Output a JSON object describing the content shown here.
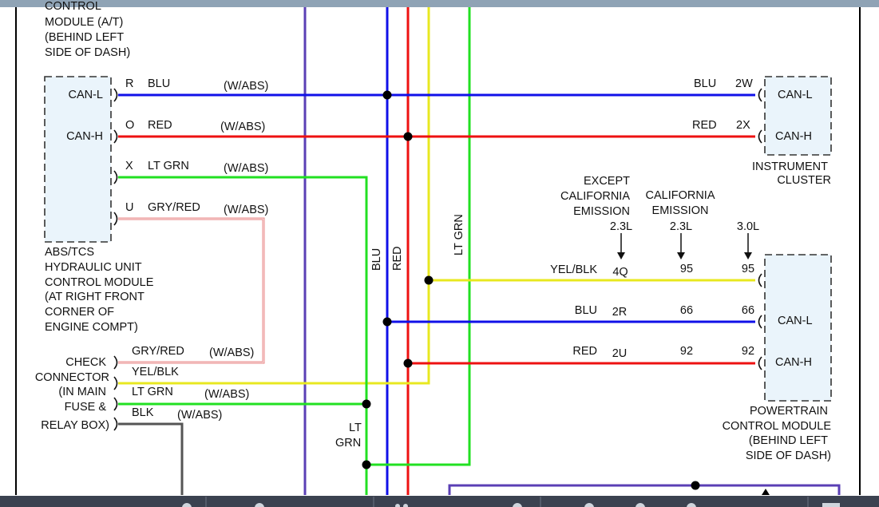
{
  "colors": {
    "blue": "#1010e8",
    "red": "#ee1111",
    "green": "#22e022",
    "yellow": "#e8e820",
    "grey_red": "#e88a8a",
    "black": "#555555",
    "purple": "#5a3fb5",
    "frame": "#000000",
    "toolbar": "#3b4250",
    "topbar": "#8fa3b5"
  },
  "toolbar": {
    "icons": [
      "toolbar-icon-1",
      "toolbar-icon-2",
      "toolbar-icon-3",
      "toolbar-icon-4",
      "toolbar-icon-5",
      "toolbar-icon-6",
      "toolbar-icon-7",
      "toolbar-icon-8",
      "toolbar-icon-9"
    ]
  },
  "pcm_top_label": [
    "CONTROL",
    "MODULE (A/T)",
    "(BEHIND LEFT",
    "SIDE OF DASH)"
  ],
  "abs_module": {
    "pins": [
      "CAN-L",
      "CAN-H"
    ],
    "label": [
      "ABS/TCS",
      "HYDRAULIC UNIT",
      "CONTROL MODULE",
      "(AT RIGHT FRONT",
      "CORNER OF",
      "ENGINE COMPT)"
    ],
    "wires": [
      {
        "pin": "R",
        "color": "BLU",
        "note": "(W/ABS)"
      },
      {
        "pin": "O",
        "color": "RED",
        "note": "(W/ABS)"
      },
      {
        "pin": "X",
        "color": "LT GRN",
        "note": "(W/ABS)"
      },
      {
        "pin": "U",
        "color": "GRY/RED",
        "note": "(W/ABS)"
      }
    ]
  },
  "instrument_cluster": {
    "pins": [
      "CAN-L",
      "CAN-H"
    ],
    "label": [
      "INSTRUMENT",
      "CLUSTER"
    ],
    "wires": [
      {
        "color": "BLU",
        "pin": "2W"
      },
      {
        "color": "RED",
        "pin": "2X"
      }
    ]
  },
  "vertical_labels": {
    "blu": "BLU",
    "red": "RED",
    "lt_grn": "LT GRN"
  },
  "lt_grn_lower": [
    "LT",
    "GRN"
  ],
  "emission": {
    "except_ca": [
      "EXCEPT",
      "CALIFORNIA",
      "EMISSION"
    ],
    "ca": [
      "CALIFORNIA",
      "EMISSION"
    ],
    "engines": [
      "2.3L",
      "2.3L",
      "3.0L"
    ]
  },
  "pcm_wires": [
    {
      "color": "YEL/BLK",
      "pins": [
        "4Q",
        "95",
        "95"
      ]
    },
    {
      "color": "BLU",
      "pins": [
        "2R",
        "66",
        "66"
      ]
    },
    {
      "color": "RED",
      "pins": [
        "2U",
        "92",
        "92"
      ]
    }
  ],
  "pcm_box": {
    "pins": [
      "CAN-L",
      "CAN-H"
    ],
    "label": [
      "POWERTRAIN",
      "CONTROL MODULE",
      "(BEHIND LEFT",
      "SIDE OF DASH)"
    ]
  },
  "check_connector": {
    "label": [
      "CHECK",
      "CONNECTOR",
      "(IN MAIN",
      "FUSE &",
      "RELAY BOX)"
    ],
    "wires": [
      {
        "color": "GRY/RED",
        "note": "(W/ABS)"
      },
      {
        "color": "YEL/BLK",
        "note": ""
      },
      {
        "color": "LT GRN",
        "note": "(W/ABS)"
      },
      {
        "color": "BLK",
        "note": "(W/ABS)"
      }
    ]
  }
}
